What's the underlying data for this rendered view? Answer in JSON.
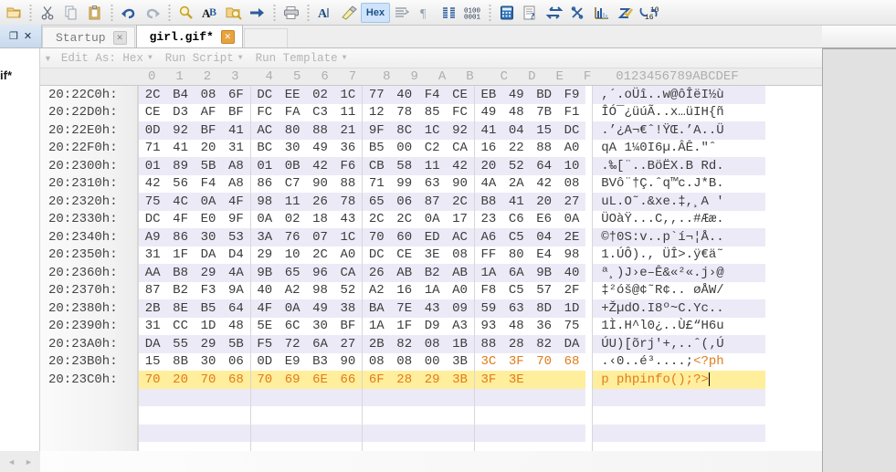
{
  "toolbar": {
    "icons": [
      {
        "name": "open-folder-icon",
        "glyph": "🗀"
      },
      {
        "name": "cut-icon",
        "glyph": "✂"
      },
      {
        "name": "copy-icon",
        "glyph": "🗐"
      },
      {
        "name": "paste-icon",
        "glyph": "📋"
      },
      {
        "name": "undo-icon",
        "glyph": "↩"
      },
      {
        "name": "redo-icon",
        "glyph": "↪"
      },
      {
        "name": "find-icon",
        "glyph": "🔍"
      },
      {
        "name": "replace-icon",
        "glyph": "AB"
      },
      {
        "name": "find-in-files-icon",
        "glyph": "🗂"
      },
      {
        "name": "goto-icon",
        "glyph": "➜"
      },
      {
        "name": "print-icon",
        "glyph": "🖨"
      },
      {
        "name": "font-icon",
        "glyph": "A"
      },
      {
        "name": "highlight-icon",
        "glyph": "✐"
      },
      {
        "name": "hex-mode-icon",
        "glyph": "Hex"
      },
      {
        "name": "line-wrap-icon",
        "glyph": "≣"
      },
      {
        "name": "paragraph-icon",
        "glyph": "¶"
      },
      {
        "name": "columns-icon",
        "glyph": "▥"
      },
      {
        "name": "binary-icon",
        "glyph": "0100"
      },
      {
        "name": "calculator-icon",
        "glyph": "▦"
      },
      {
        "name": "inspector-icon",
        "glyph": "📄"
      },
      {
        "name": "swap-bytes-icon",
        "glyph": "⇄"
      },
      {
        "name": "checksum-icon",
        "glyph": "%"
      },
      {
        "name": "histogram-icon",
        "glyph": "📊"
      },
      {
        "name": "verify-icon",
        "glyph": "✓"
      },
      {
        "name": "base-convert-icon",
        "glyph": "16"
      }
    ]
  },
  "tabstrip": {
    "pane_restore_label": "❐",
    "pane_close_label": "✕",
    "tabs": [
      {
        "label": "Startup",
        "close": "✕",
        "active": false
      },
      {
        "label": "girl.gif*",
        "close": "✕",
        "active": true
      }
    ]
  },
  "leftdock": {
    "label": "if*",
    "scroll_left": "◄",
    "scroll_right": "►"
  },
  "subtoolbar": {
    "dropmark": "▼",
    "items": [
      {
        "label": "Edit As: Hex",
        "caret": "▼"
      },
      {
        "label": "Run Script",
        "caret": "▼"
      },
      {
        "label": "Run Template",
        "caret": "▼"
      }
    ]
  },
  "column_header": {
    "address_label": "",
    "hex_columns": [
      "0",
      "1",
      "2",
      "3",
      "4",
      "5",
      "6",
      "7",
      "8",
      "9",
      "A",
      "B",
      "C",
      "D",
      "E",
      "F"
    ],
    "ascii_label": "0123456789ABCDEF"
  },
  "hex_rows": [
    {
      "addr": "20:22C0h:",
      "bytes": [
        "2C",
        "B4",
        "08",
        "6F",
        "DC",
        "EE",
        "02",
        "1C",
        "77",
        "40",
        "F4",
        "CE",
        "EB",
        "49",
        "BD",
        "F9"
      ],
      "ascii": ",´.oÜî..w@ôÎëI½ù",
      "alt": true,
      "selected": false,
      "hl_from": null
    },
    {
      "addr": "20:22D0h:",
      "bytes": [
        "CE",
        "D3",
        "AF",
        "BF",
        "FC",
        "FA",
        "C3",
        "11",
        "12",
        "78",
        "85",
        "FC",
        "49",
        "48",
        "7B",
        "F1"
      ],
      "ascii": "ÎÓ¯¿üúÃ..x…üIH{ñ",
      "alt": false,
      "selected": false,
      "hl_from": null
    },
    {
      "addr": "20:22E0h:",
      "bytes": [
        "0D",
        "92",
        "BF",
        "41",
        "AC",
        "80",
        "88",
        "21",
        "9F",
        "8C",
        "1C",
        "92",
        "41",
        "04",
        "15",
        "DC"
      ],
      "ascii": ".’¿A¬€ˆ!ŸŒ.’A..Ü",
      "alt": true,
      "selected": false,
      "hl_from": null
    },
    {
      "addr": "20:22F0h:",
      "bytes": [
        "71",
        "41",
        "20",
        "31",
        "BC",
        "30",
        "49",
        "36",
        "B5",
        "00",
        "C2",
        "CA",
        "16",
        "22",
        "88",
        "A0"
      ],
      "ascii": "qA 1¼0I6µ.ÂÊ.\"ˆ",
      "alt": false,
      "selected": false,
      "hl_from": null
    },
    {
      "addr": "20:2300h:",
      "bytes": [
        "01",
        "89",
        "5B",
        "A8",
        "01",
        "0B",
        "42",
        "F6",
        "CB",
        "58",
        "11",
        "42",
        "20",
        "52",
        "64",
        "10"
      ],
      "ascii": ".‰[¨..BöËX.B Rd.",
      "alt": true,
      "selected": false,
      "hl_from": null
    },
    {
      "addr": "20:2310h:",
      "bytes": [
        "42",
        "56",
        "F4",
        "A8",
        "86",
        "C7",
        "90",
        "88",
        "71",
        "99",
        "63",
        "90",
        "4A",
        "2A",
        "42",
        "08"
      ],
      "ascii": "BVô¨†Ç.ˆq™c.J*B.",
      "alt": false,
      "selected": false,
      "hl_from": null
    },
    {
      "addr": "20:2320h:",
      "bytes": [
        "75",
        "4C",
        "0A",
        "4F",
        "98",
        "11",
        "26",
        "78",
        "65",
        "06",
        "87",
        "2C",
        "B8",
        "41",
        "20",
        "27"
      ],
      "ascii": "uL.O˜.&xe.‡,¸A '",
      "alt": true,
      "selected": false,
      "hl_from": null
    },
    {
      "addr": "20:2330h:",
      "bytes": [
        "DC",
        "4F",
        "E0",
        "9F",
        "0A",
        "02",
        "18",
        "43",
        "2C",
        "2C",
        "0A",
        "17",
        "23",
        "C6",
        "E6",
        "0A"
      ],
      "ascii": "ÜOàŸ...C,,..#Ææ.",
      "alt": false,
      "selected": false,
      "hl_from": null
    },
    {
      "addr": "20:2340h:",
      "bytes": [
        "A9",
        "86",
        "30",
        "53",
        "3A",
        "76",
        "07",
        "1C",
        "70",
        "60",
        "ED",
        "AC",
        "A6",
        "C5",
        "04",
        "2E"
      ],
      "ascii": "©†0S:v..p`í¬¦Å..",
      "alt": true,
      "selected": false,
      "hl_from": null
    },
    {
      "addr": "20:2350h:",
      "bytes": [
        "31",
        "1F",
        "DA",
        "D4",
        "29",
        "10",
        "2C",
        "A0",
        "DC",
        "CE",
        "3E",
        "08",
        "FF",
        "80",
        "E4",
        "98"
      ],
      "ascii": "1.ÚÔ)., ÜÎ>.ÿ€ä˜",
      "alt": false,
      "selected": false,
      "hl_from": null
    },
    {
      "addr": "20:2360h:",
      "bytes": [
        "AA",
        "B8",
        "29",
        "4A",
        "9B",
        "65",
        "96",
        "CA",
        "26",
        "AB",
        "B2",
        "AB",
        "1A",
        "6A",
        "9B",
        "40"
      ],
      "ascii": "ª¸)J›e–Ê&«²«.j›@",
      "alt": true,
      "selected": false,
      "hl_from": null
    },
    {
      "addr": "20:2370h:",
      "bytes": [
        "87",
        "B2",
        "F3",
        "9A",
        "40",
        "A2",
        "98",
        "52",
        "A2",
        "16",
        "1A",
        "A0",
        "F8",
        "C5",
        "57",
        "2F"
      ],
      "ascii": "‡²óš@¢˜R¢.. øÅW/",
      "alt": false,
      "selected": false,
      "hl_from": null
    },
    {
      "addr": "20:2380h:",
      "bytes": [
        "2B",
        "8E",
        "B5",
        "64",
        "4F",
        "0A",
        "49",
        "38",
        "BA",
        "7E",
        "43",
        "09",
        "59",
        "63",
        "8D",
        "1D"
      ],
      "ascii": "+ŽµdO.I8º~C.Yc..",
      "alt": true,
      "selected": false,
      "hl_from": null
    },
    {
      "addr": "20:2390h:",
      "bytes": [
        "31",
        "CC",
        "1D",
        "48",
        "5E",
        "6C",
        "30",
        "BF",
        "1A",
        "1F",
        "D9",
        "A3",
        "93",
        "48",
        "36",
        "75"
      ],
      "ascii": "1Ì.H^l0¿..Ù£“H6u",
      "alt": false,
      "selected": false,
      "hl_from": null
    },
    {
      "addr": "20:23A0h:",
      "bytes": [
        "DA",
        "55",
        "29",
        "5B",
        "F5",
        "72",
        "6A",
        "27",
        "2B",
        "82",
        "08",
        "1B",
        "88",
        "28",
        "82",
        "DA"
      ],
      "ascii": "ÚU)[õrj'+‚..ˆ(‚Ú",
      "alt": true,
      "selected": false,
      "hl_from": null
    },
    {
      "addr": "20:23B0h:",
      "bytes": [
        "15",
        "8B",
        "30",
        "06",
        "0D",
        "E9",
        "B3",
        "90",
        "08",
        "08",
        "00",
        "3B",
        "3C",
        "3F",
        "70",
        "68"
      ],
      "ascii": ".‹0..é³....;<?ph",
      "alt": false,
      "selected": false,
      "hl_from": 12,
      "ascii_plain": ".‹0..é³....;",
      "ascii_hl": "<?ph"
    },
    {
      "addr": "20:23C0h:",
      "bytes": [
        "70",
        "20",
        "70",
        "68",
        "70",
        "69",
        "6E",
        "66",
        "6F",
        "28",
        "29",
        "3B",
        "3F",
        "3E"
      ],
      "ascii": "p phpinfo();?>",
      "alt": false,
      "selected": true,
      "hl_from": 0
    }
  ],
  "blank_rows": 4,
  "colors": {
    "highlight_bg": "#ffee9c",
    "highlight_text": "#e07b1a",
    "alt_row_bg": "#eceaf7",
    "accent": "#cfe4fa"
  }
}
